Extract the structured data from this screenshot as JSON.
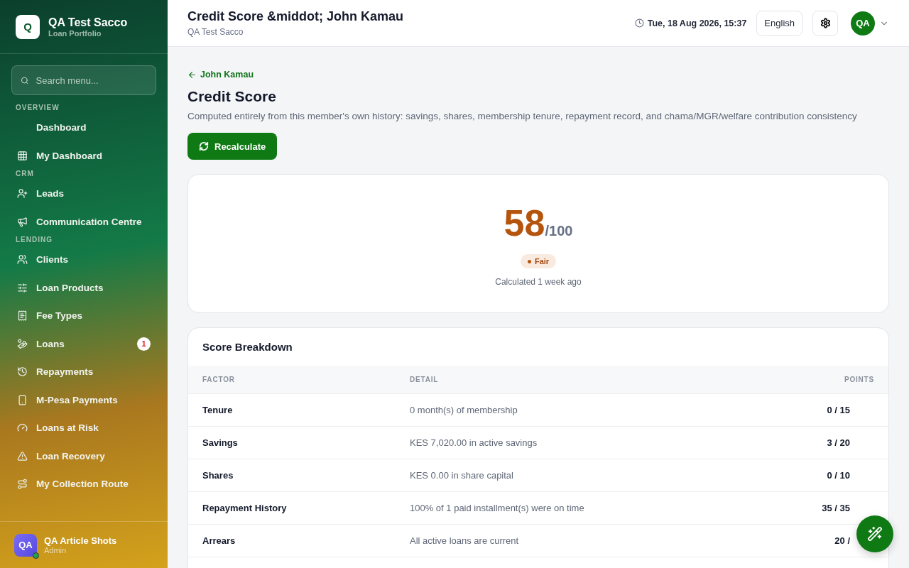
{
  "brand": {
    "logo": "Q",
    "name": "QA Test Sacco",
    "subtitle": "Loan Portfolio"
  },
  "sidebar": {
    "search": {
      "placeholder": "Search menu..."
    },
    "sections": [
      {
        "title": "OVERVIEW",
        "items": [
          {
            "label": "Dashboard"
          },
          {
            "label": "My Dashboard"
          }
        ]
      },
      {
        "title": "CRM",
        "items": [
          {
            "label": "Leads"
          },
          {
            "label": "Communication Centre"
          }
        ]
      },
      {
        "title": "LENDING",
        "items": [
          {
            "label": "Clients"
          },
          {
            "label": "Loan Products"
          },
          {
            "label": "Fee Types"
          },
          {
            "label": "Loans",
            "badge": "1"
          },
          {
            "label": "Repayments"
          },
          {
            "label": "M-Pesa Payments"
          },
          {
            "label": "Loans at Risk"
          },
          {
            "label": "Loan Recovery"
          },
          {
            "label": "My Collection Route"
          }
        ]
      }
    ]
  },
  "user": {
    "initials": "QA",
    "name": "QA Article Shots",
    "role": "Admin",
    "online": true
  },
  "header": {
    "title": "Credit Score &middot; John Kamau",
    "subtitle": "QA Test Sacco",
    "datetime": "Tue, 18 Aug 2026, 15:37",
    "language": "English",
    "avatar": "QA"
  },
  "back_link": "John Kamau",
  "page_title": "Credit Score",
  "description": "Computed entirely from this member's own history: savings, shares, membership tenure, repayment record, and chama/MGR/welfare contribution consistency",
  "recalculate_button": "Recalculate",
  "score": {
    "value": "58",
    "max": "/100",
    "rating": "Fair",
    "calculated": "Calculated 1 week ago"
  },
  "breakdown": {
    "title": "Score Breakdown",
    "columns": [
      "FACTOR",
      "DETAIL",
      "POINTS"
    ],
    "rows": [
      {
        "factor": "Tenure",
        "detail": "0 month(s) of membership",
        "points": "0 / 15"
      },
      {
        "factor": "Savings",
        "detail": "KES 7,020.00 in active savings",
        "points": "3 / 20"
      },
      {
        "factor": "Shares",
        "detail": "KES 0.00 in share capital",
        "points": "0 / 10"
      },
      {
        "factor": "Repayment History",
        "detail": "100% of 1 paid installment(s) were on time",
        "points": "35 / 35"
      },
      {
        "factor": "Arrears",
        "detail": "All active loans are current",
        "points": "20 /"
      }
    ]
  }
}
